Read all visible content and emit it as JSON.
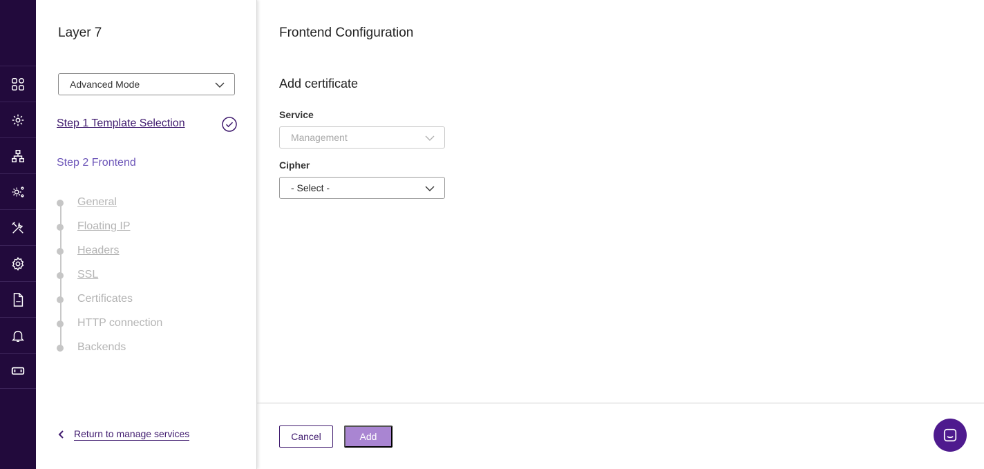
{
  "rail": {
    "items": [
      {
        "icon": "dashboard-grid-icon"
      },
      {
        "icon": "services-gear-icon"
      },
      {
        "icon": "network-topology-icon"
      },
      {
        "icon": "advanced-settings-icon"
      },
      {
        "icon": "tools-icon"
      },
      {
        "icon": "settings-gear-icon"
      },
      {
        "icon": "log-file-icon"
      },
      {
        "icon": "notifications-bell-icon"
      },
      {
        "icon": "ticket-icon"
      }
    ]
  },
  "sidebar": {
    "title": "Layer 7",
    "mode_select": {
      "value": "Advanced Mode"
    },
    "step1": {
      "label": "Step 1 Template Selection",
      "completed": true
    },
    "step2": {
      "label": "Step 2 Frontend"
    },
    "substeps": [
      {
        "label": "General",
        "link": true
      },
      {
        "label": "Floating IP",
        "link": true
      },
      {
        "label": "Headers",
        "link": true
      },
      {
        "label": "SSL",
        "link": true
      },
      {
        "label": "Certificates",
        "link": false
      },
      {
        "label": "HTTP connection",
        "link": false
      },
      {
        "label": "Backends",
        "link": false
      }
    ],
    "return_link": "Return to manage services"
  },
  "main": {
    "title": "Frontend Configuration",
    "section_title": "Add certificate",
    "service": {
      "label": "Service",
      "value": "Management",
      "disabled": true
    },
    "cipher": {
      "label": "Cipher",
      "value": "- Select -"
    }
  },
  "footer": {
    "cancel_label": "Cancel",
    "add_label": "Add"
  },
  "colors": {
    "rail_bg": "#220a3c",
    "accent": "#3f1a6e",
    "step2": "#6c55b8",
    "add_button": "#a985d2",
    "chat_bubble": "#4e1a8e"
  }
}
